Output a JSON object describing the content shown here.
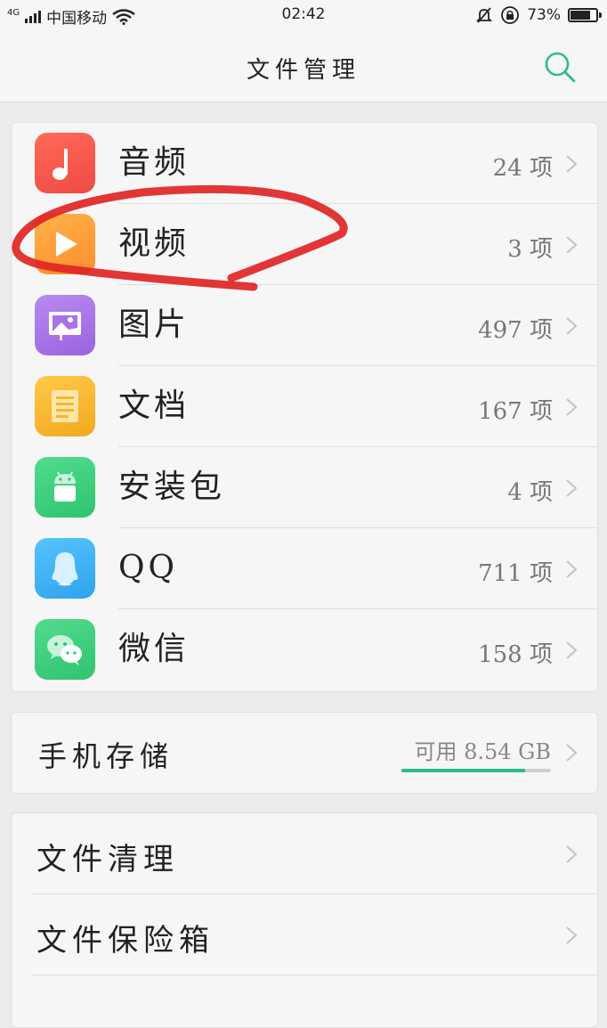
{
  "status_bar": {
    "network": "4G",
    "carrier": "中国移动",
    "time": "02:42",
    "battery": "73%",
    "battery_level": 0.73
  },
  "header": {
    "title": "文件管理",
    "search_icon": "search-icon"
  },
  "categories": [
    {
      "label": "音频",
      "count": "24 项",
      "icon": "music-note-icon",
      "color": "#f0534a"
    },
    {
      "label": "视频",
      "count": "3 项",
      "icon": "play-icon",
      "color": "#ff9a3c"
    },
    {
      "label": "图片",
      "count": "497 项",
      "icon": "image-icon",
      "color": "#a873e8"
    },
    {
      "label": "文档",
      "count": "167 项",
      "icon": "document-icon",
      "color": "#f5b72e"
    },
    {
      "label": "安装包",
      "count": "4 项",
      "icon": "android-icon",
      "color": "#3ed17f"
    },
    {
      "label": "QQ",
      "count": "711 项",
      "icon": "qq-penguin-icon",
      "color": "#3fb2f2"
    },
    {
      "label": "微信",
      "count": "158 项",
      "icon": "wechat-icon",
      "color": "#3ed17f"
    }
  ],
  "storage": {
    "label": "手机存储",
    "free": "可用 8.54 GB",
    "used_fraction": 0.83
  },
  "tools": [
    {
      "label": "文件清理"
    },
    {
      "label": "文件保险箱"
    },
    {
      "label": ""
    }
  ],
  "colors": {
    "accent": "#2bbc8a",
    "annotation": "#e02424"
  }
}
